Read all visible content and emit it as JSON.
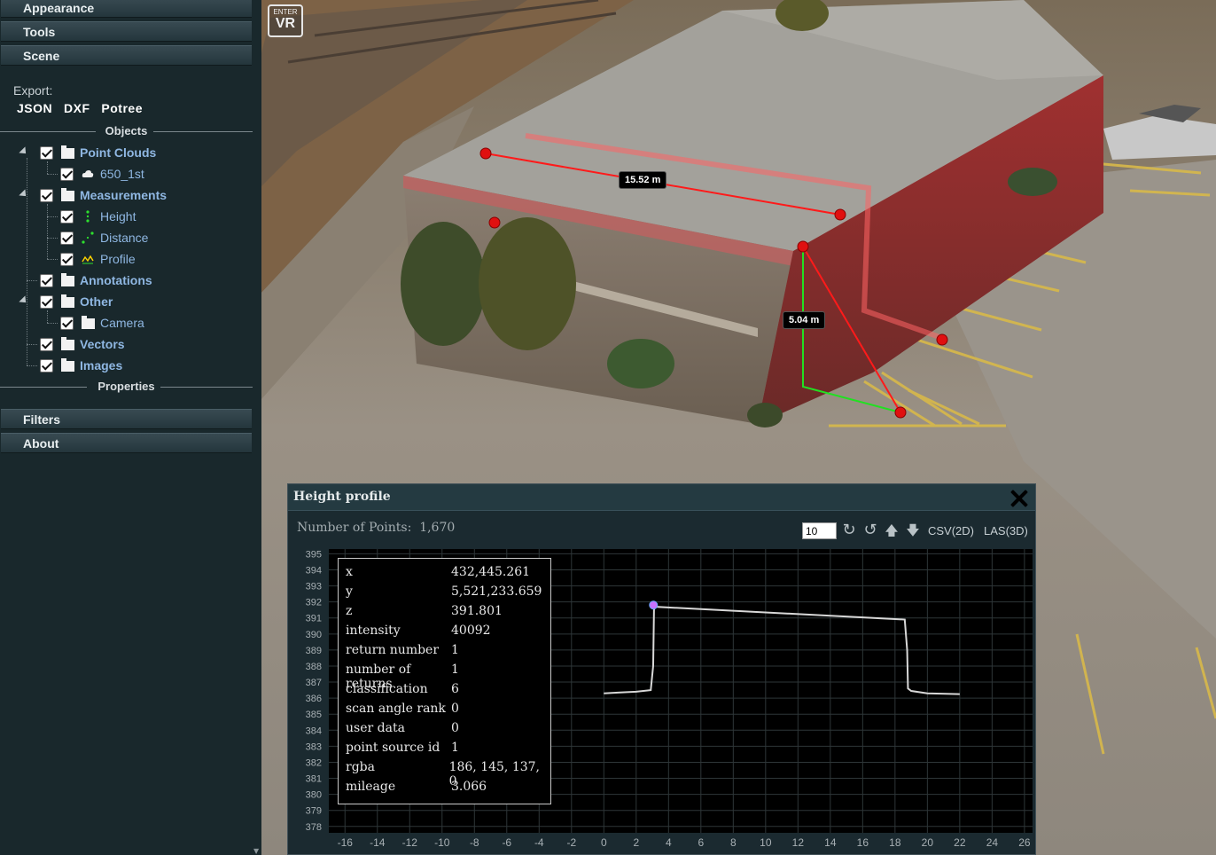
{
  "sidebar": {
    "menus_top": [
      {
        "label": "Appearance"
      },
      {
        "label": "Tools"
      },
      {
        "label": "Scene"
      }
    ],
    "export": {
      "label": "Export:",
      "links": [
        "JSON",
        "DXF",
        "Potree"
      ]
    },
    "objects_heading": "Objects",
    "tree": [
      {
        "label": "Point Clouds",
        "icon": "folder-icon"
      },
      {
        "label": "650_1st",
        "icon": "cloud-icon"
      },
      {
        "label": "Measurements",
        "icon": "folder-icon"
      },
      {
        "label": "Height",
        "icon": "height-measure-icon"
      },
      {
        "label": "Distance",
        "icon": "distance-measure-icon"
      },
      {
        "label": "Profile",
        "icon": "profile-measure-icon"
      },
      {
        "label": "Annotations",
        "icon": "folder-icon"
      },
      {
        "label": "Other",
        "icon": "folder-icon"
      },
      {
        "label": "Camera",
        "icon": "folder-icon"
      },
      {
        "label": "Vectors",
        "icon": "folder-icon"
      },
      {
        "label": "Images",
        "icon": "folder-icon"
      }
    ],
    "properties_heading": "Properties",
    "menus_bottom": [
      {
        "label": "Filters"
      },
      {
        "label": "About"
      }
    ]
  },
  "viewport": {
    "vr_button": {
      "small": "ENTER",
      "big": "VR"
    },
    "measurements": {
      "distance_label": "15.52 m",
      "height_label": "5.04 m"
    },
    "colors": {
      "distance": "#ff2020",
      "height": "#20dd20",
      "marker": "#e01010"
    }
  },
  "profile": {
    "title": "Height profile",
    "points_label": "Number of Points:",
    "points_value": "1,670",
    "range_value": "10",
    "buttons": {
      "rotate_cw": "↻",
      "rotate_ccw": "↺",
      "up": "🡅",
      "down": "🡇"
    },
    "export_csv": "CSV(2D)",
    "export_las": "LAS(3D)",
    "point_info": [
      {
        "key": "x",
        "value": "432,445.261"
      },
      {
        "key": "y",
        "value": "5,521,233.659"
      },
      {
        "key": "z",
        "value": "391.801"
      },
      {
        "key": "intensity",
        "value": "40092"
      },
      {
        "key": "return number",
        "value": "1"
      },
      {
        "key": "number of returns",
        "value": "1"
      },
      {
        "key": "classification",
        "value": "6"
      },
      {
        "key": "scan angle rank",
        "value": "0"
      },
      {
        "key": "user data",
        "value": "0"
      },
      {
        "key": "point source id",
        "value": "1"
      },
      {
        "key": "rgba",
        "value": "186, 145, 137, 0"
      },
      {
        "key": "mileage",
        "value": "3.066"
      }
    ]
  },
  "chart_data": {
    "type": "line",
    "title": "",
    "xlabel": "",
    "ylabel": "",
    "xlim": [
      -17,
      26.5
    ],
    "ylim": [
      377.6,
      395.3
    ],
    "x_ticks": [
      -16,
      -14,
      -12,
      -10,
      -8,
      -6,
      -4,
      -2,
      0,
      2,
      4,
      6,
      8,
      10,
      12,
      14,
      16,
      18,
      20,
      22,
      24,
      26
    ],
    "y_ticks": [
      395,
      394,
      393,
      392,
      391,
      390,
      389,
      388,
      387,
      386,
      385,
      384,
      383,
      382,
      381,
      380,
      379,
      378
    ],
    "grid": true,
    "series": [
      {
        "x": [
          0,
          1,
          2,
          2.9,
          3.05,
          3.1,
          3.15,
          18.6,
          18.75,
          18.8,
          19,
          20,
          22
        ],
        "y": [
          386.3,
          386.35,
          386.4,
          386.5,
          388,
          391.5,
          391.7,
          390.9,
          389,
          386.6,
          386.45,
          386.3,
          386.25
        ]
      }
    ],
    "highlight_point": {
      "x": 3.066,
      "y": 391.801,
      "color": "#c870ff"
    },
    "colors": {
      "line": "#d8d8d8",
      "grid": "#2e3638",
      "background": "#000000"
    }
  }
}
